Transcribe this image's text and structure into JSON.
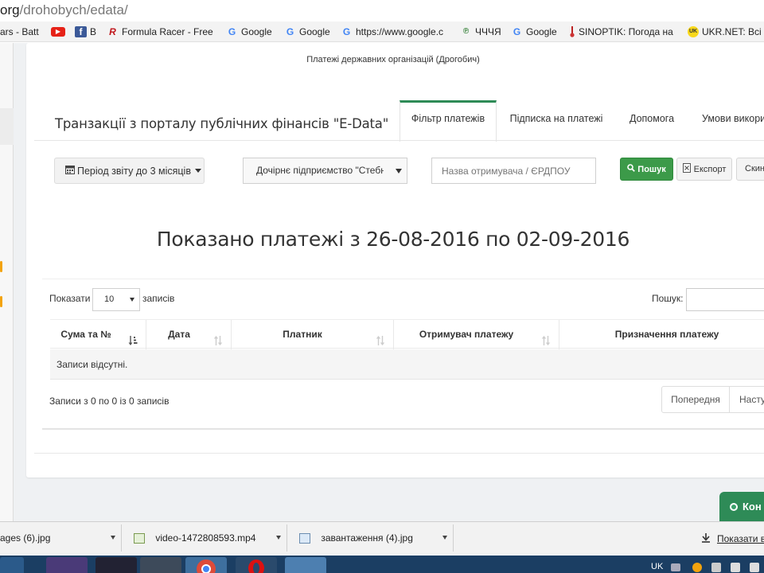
{
  "browser": {
    "url_host": "org",
    "url_path": "/drohobych/edata/",
    "bookmarks": [
      {
        "label": "ars - Batt",
        "icon": "page-icon"
      },
      {
        "label": "",
        "icon": "youtube-icon"
      },
      {
        "label": "B",
        "icon": "facebook-icon"
      },
      {
        "label": "Formula Racer - Free",
        "icon": "racer-icon"
      },
      {
        "label": "Google",
        "icon": "google-icon"
      },
      {
        "label": "Google",
        "icon": "google-icon"
      },
      {
        "label": "https://www.google.c",
        "icon": "google-icon"
      },
      {
        "label": "ЧЧЧЯ",
        "icon": "chchchya-icon"
      },
      {
        "label": "Google",
        "icon": "google-icon"
      },
      {
        "label": "SINOPTIK: Погода на",
        "icon": "thermometer-icon"
      },
      {
        "label": "UKR.NET: Всі н",
        "icon": "ukrnet-icon"
      }
    ]
  },
  "page": {
    "subtitle": "Платежі державних організацій (Дрогобич)",
    "title": "Транзакції з порталу публічних фінансів \"E-Data\"",
    "tabs": [
      {
        "label": "Фільтр платежів",
        "active": true
      },
      {
        "label": "Підписка на платежі",
        "active": false
      },
      {
        "label": "Допомога",
        "active": false
      },
      {
        "label": "Умови викори",
        "active": false
      }
    ],
    "filters": {
      "period_label": "Період звіту до 3 місяців",
      "organization_value": "Дочірнє підприємство \"Стебни",
      "recipient_placeholder": "Назва отримувача / ЄРДПОУ",
      "search_label": "Пошук",
      "export_label": "Експорт",
      "reset_label": "Скину"
    },
    "result_heading": "Показано платежі з 26-08-2016 по 02-09-2016"
  },
  "table": {
    "show_label": "Показати",
    "page_size": "10",
    "records_label": "записів",
    "search_label": "Пошук:",
    "columns": [
      "Сума та №",
      "Дата",
      "Платник",
      "Отримувач платежу",
      "Призначення платежу"
    ],
    "empty_text": "Записи відсутні.",
    "info": "Записи з 0 по 0 із 0 записів",
    "prev_label": "Попередня",
    "next_label": "Насту"
  },
  "contact_label": "Кон",
  "downloads": {
    "items": [
      {
        "label": "ages (6).jpg"
      },
      {
        "label": "video-1472808593.mp4"
      },
      {
        "label": "завантаження (4).jpg"
      }
    ],
    "show_all": "Показати в"
  },
  "taskbar": {
    "language": "UK"
  },
  "colors": {
    "accent_green": "#2e8b57",
    "search_button": "#3c9a49",
    "taskbar": "#1b3e63"
  }
}
